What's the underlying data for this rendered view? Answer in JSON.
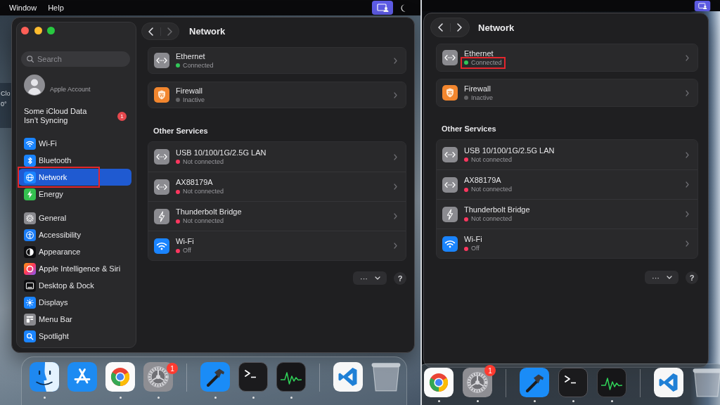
{
  "left_screenshot": {
    "menu_bar": {
      "items": [
        "Window",
        "Help"
      ]
    },
    "desktop_widget": {
      "lines": [
        "Clo",
        "0°"
      ]
    },
    "window": {
      "sidebar": {
        "search": {
          "placeholder": "Search"
        },
        "account": {
          "subtitle": "Apple Account"
        },
        "alert": {
          "text": "Some iCloud Data Isn’t Syncing",
          "badge": "1"
        },
        "groups": [
          {
            "items": [
              {
                "label": "Wi-Fi",
                "selected": false,
                "outlined": false
              },
              {
                "label": "Bluetooth",
                "selected": false,
                "outlined": false
              },
              {
                "label": "Network",
                "selected": true,
                "outlined": true
              },
              {
                "label": "Energy",
                "selected": false,
                "outlined": false
              }
            ]
          },
          {
            "items": [
              {
                "label": "General",
                "selected": false,
                "outlined": false
              },
              {
                "label": "Accessibility",
                "selected": false,
                "outlined": false
              },
              {
                "label": "Appearance",
                "selected": false,
                "outlined": false
              },
              {
                "label": "Apple Intelligence & Siri",
                "selected": false,
                "outlined": false
              },
              {
                "label": "Desktop & Dock",
                "selected": false,
                "outlined": false
              },
              {
                "label": "Displays",
                "selected": false,
                "outlined": false
              },
              {
                "label": "Menu Bar",
                "selected": false,
                "outlined": false
              },
              {
                "label": "Spotlight",
                "selected": false,
                "outlined": false
              }
            ]
          }
        ]
      },
      "pane": {
        "title": "Network",
        "nav": {
          "forward_disabled": true
        },
        "services": [
          {
            "name": "Ethernet",
            "status": "Connected",
            "color": "#32c759",
            "outlined": false
          },
          {
            "name": "Firewall",
            "status": "Inactive",
            "color": "#636366",
            "outlined": false
          }
        ],
        "section_title": "Other Services",
        "other_services": [
          {
            "name": "USB 10/100/1G/2.5G LAN",
            "status": "Not connected",
            "color": "#ff375f",
            "outlined": false
          },
          {
            "name": "AX88179A",
            "status": "Not connected",
            "color": "#ff375f",
            "outlined": false
          },
          {
            "name": "Thunderbolt Bridge",
            "status": "Not connected",
            "color": "#ff375f",
            "outlined": false
          },
          {
            "name": "Wi-Fi",
            "status": "Off",
            "color": "#ff375f",
            "outlined": false
          }
        ],
        "more_button": {
          "label": "···"
        },
        "help_button": {
          "label": "?"
        }
      }
    },
    "dock": {
      "sections": [
        {
          "apps": [
            {
              "running": true
            },
            {
              "running": false
            },
            {
              "running": true
            },
            {
              "running": true,
              "badge": "1"
            }
          ]
        },
        {
          "apps": [
            {
              "running": true
            },
            {
              "running": true
            },
            {
              "running": true
            }
          ]
        },
        {
          "apps": [
            {
              "running": false
            },
            {
              "running": false
            }
          ]
        }
      ]
    }
  },
  "right_screenshot": {
    "window": {
      "pane": {
        "title": "Network",
        "nav": {
          "forward_disabled": false
        },
        "services": [
          {
            "name": "Ethernet",
            "status": "Connected",
            "color": "#32c759",
            "outlined": true
          },
          {
            "name": "Firewall",
            "status": "Inactive",
            "color": "#636366",
            "outlined": false
          }
        ],
        "section_title": "Other Services",
        "other_services": [
          {
            "name": "USB 10/100/1G/2.5G LAN",
            "status": "Not connected",
            "color": "#ff375f",
            "outlined": false
          },
          {
            "name": "AX88179A",
            "status": "Not connected",
            "color": "#ff375f",
            "outlined": false
          },
          {
            "name": "Thunderbolt Bridge",
            "status": "Not connected",
            "color": "#ff375f",
            "outlined": false
          },
          {
            "name": "Wi-Fi",
            "status": "Off",
            "color": "#ff375f",
            "outlined": false
          }
        ],
        "more_button": {
          "label": "···"
        },
        "help_button": {
          "label": "?"
        }
      }
    },
    "dock": {
      "sections": [
        {
          "apps": [
            {
              "running": true
            },
            {
              "running": true,
              "badge": "1"
            }
          ]
        },
        {
          "apps": [
            {
              "running": true
            },
            {
              "running": true
            },
            {
              "running": true
            }
          ]
        },
        {
          "apps": [
            {
              "running": false
            },
            {
              "running": false
            }
          ]
        }
      ]
    }
  }
}
